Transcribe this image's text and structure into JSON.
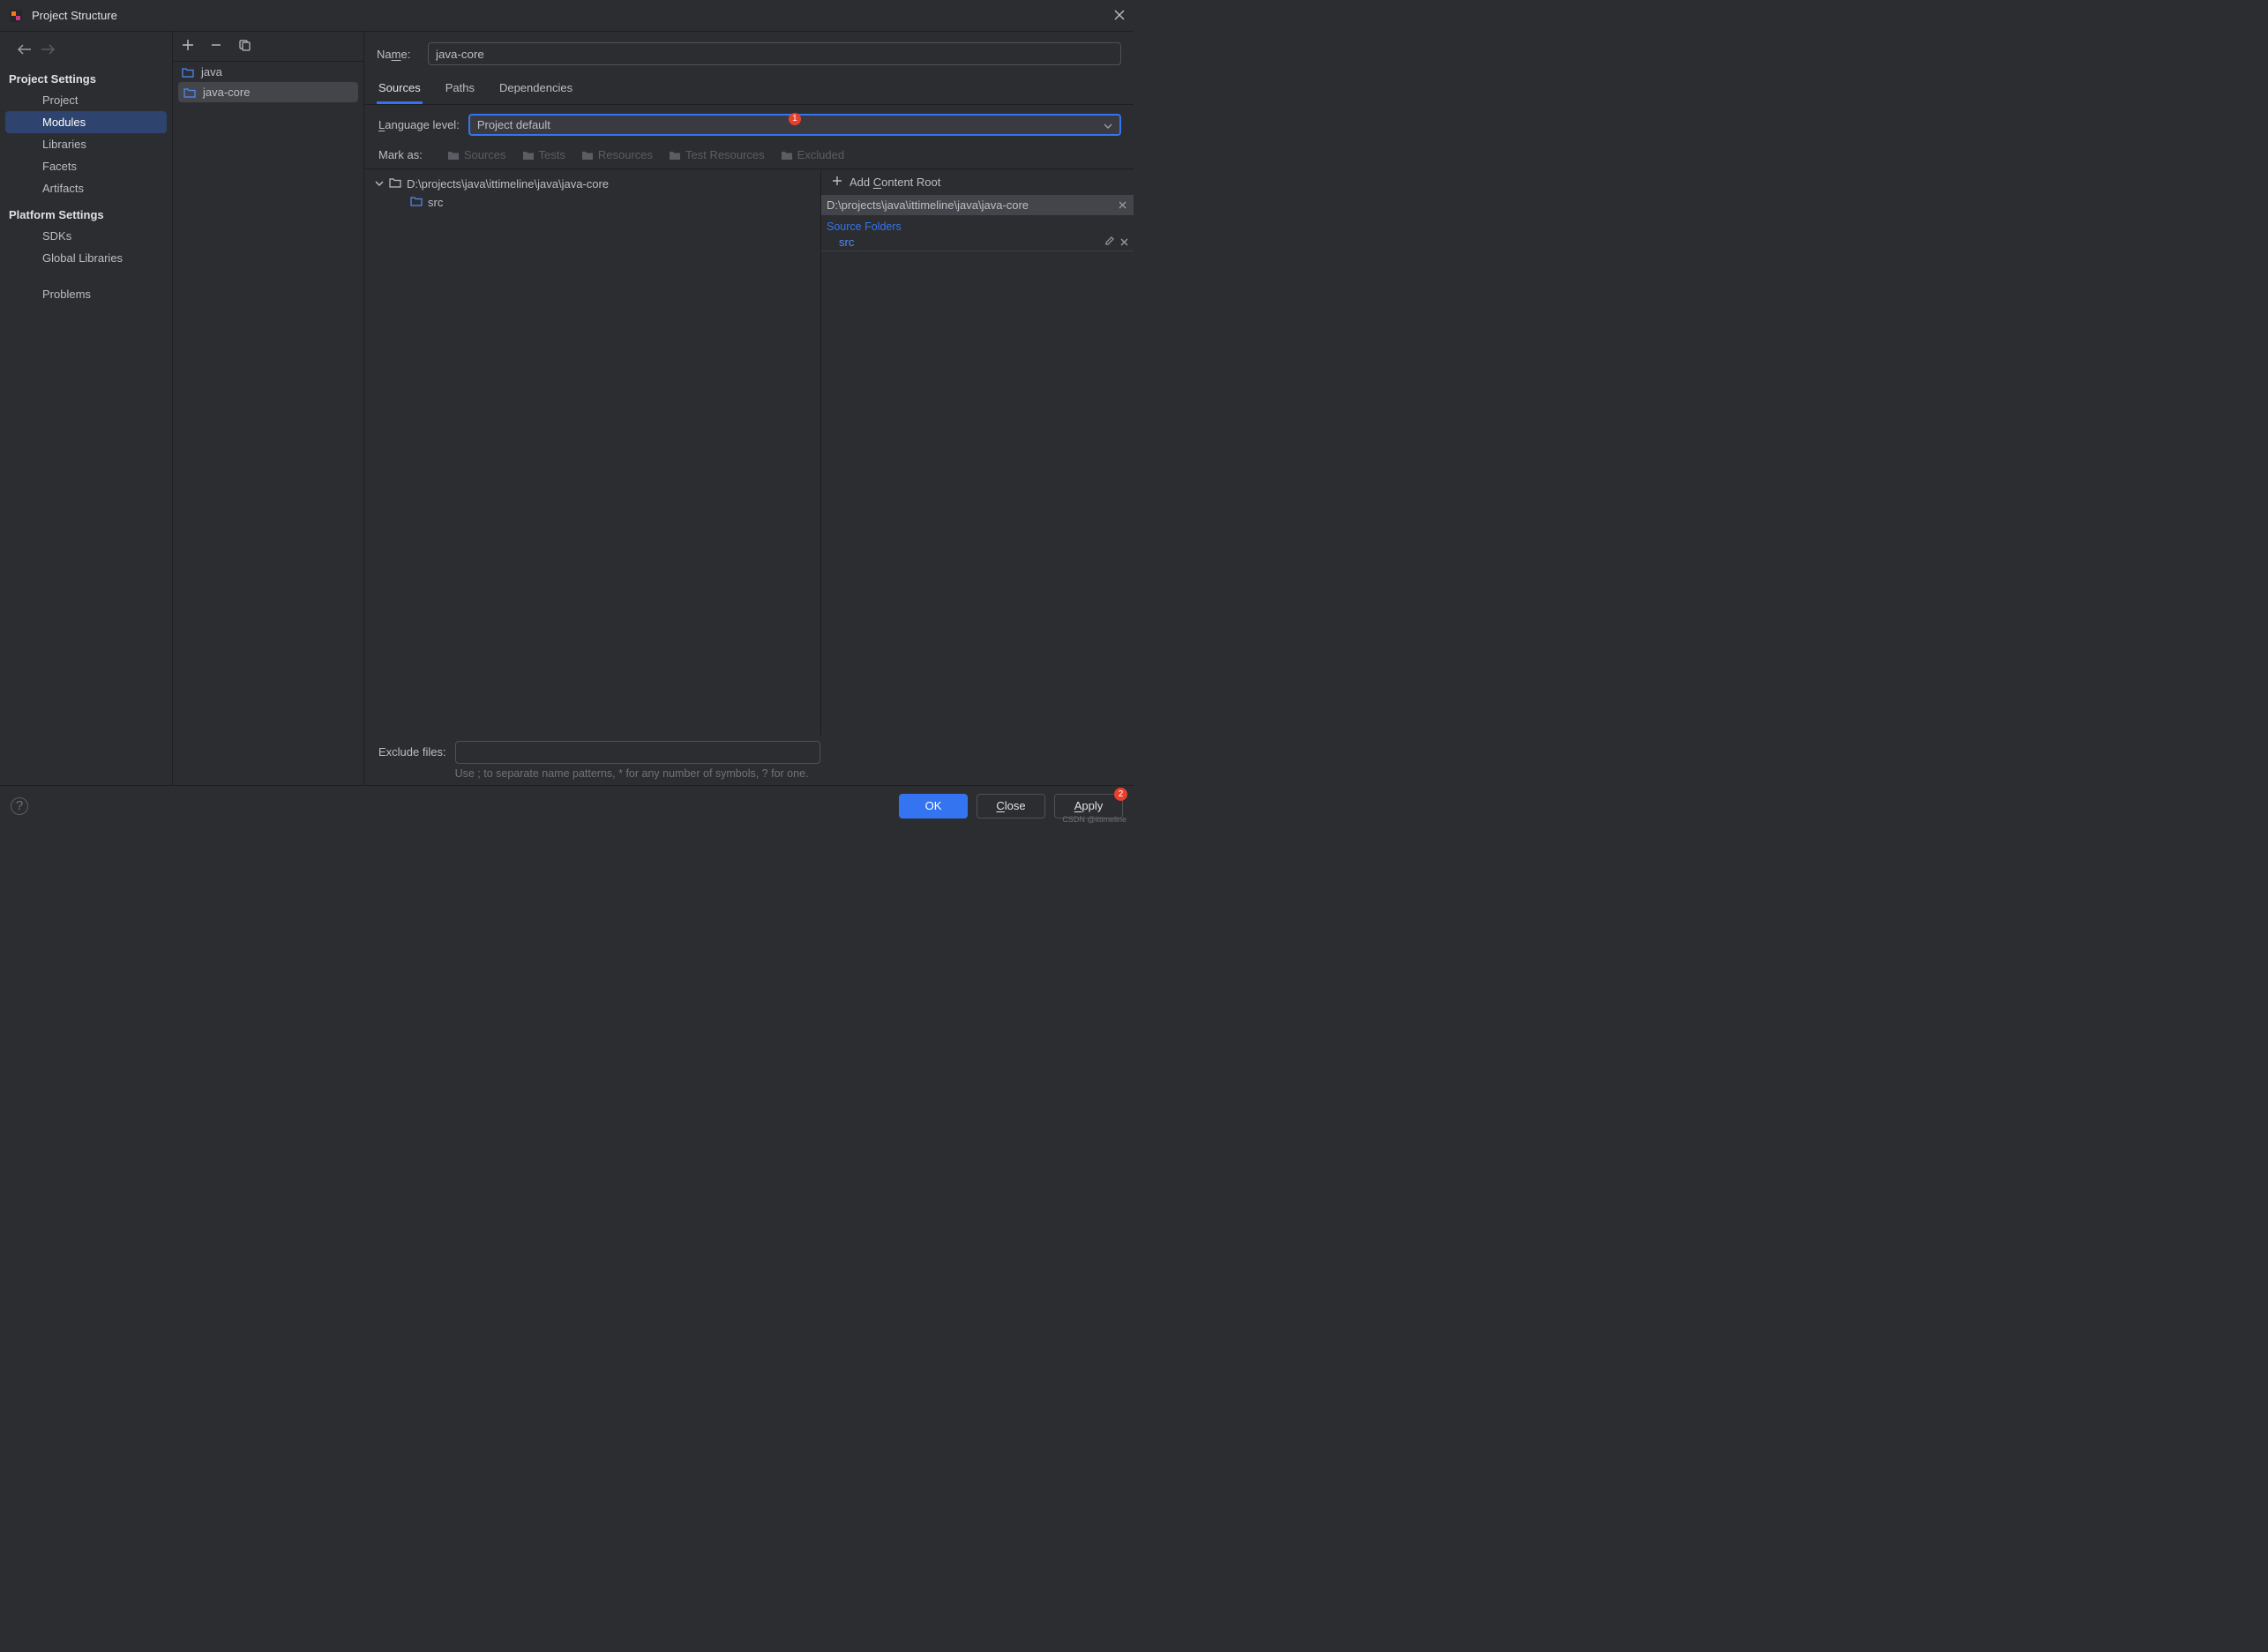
{
  "window": {
    "title": "Project Structure"
  },
  "nav": {
    "project_settings_header": "Project Settings",
    "items_ps": [
      "Project",
      "Modules",
      "Libraries",
      "Facets",
      "Artifacts"
    ],
    "platform_settings_header": "Platform Settings",
    "items_pf": [
      "SDKs",
      "Global Libraries"
    ],
    "problems": "Problems"
  },
  "modules": {
    "list": [
      "java",
      "java-core"
    ],
    "selected_index": 1
  },
  "detail": {
    "name_label": "Name:",
    "name_value": "java-core",
    "tabs": [
      "Sources",
      "Paths",
      "Dependencies"
    ],
    "lang_label": "Language level:",
    "lang_value": "Project default",
    "lang_badge": "1",
    "markas_label": "Mark as:",
    "mark_items": [
      "Sources",
      "Tests",
      "Resources",
      "Test Resources",
      "Excluded"
    ],
    "tree_root": "D:\\projects\\java\\ittimeline\\java\\java-core",
    "tree_child": "src",
    "add_content_root": "Add Content Root",
    "content_root_path": "D:\\projects\\java\\ittimeline\\java\\java-core",
    "source_folders_label": "Source Folders",
    "source_folders": [
      "src"
    ],
    "exclude_label": "Exclude files:",
    "exclude_hint": "Use ; to separate name patterns, * for any number of symbols, ? for one."
  },
  "footer": {
    "ok": "OK",
    "close": "Close",
    "apply": "Apply",
    "apply_badge": "2"
  },
  "watermark": "CSDN @ittimeline"
}
